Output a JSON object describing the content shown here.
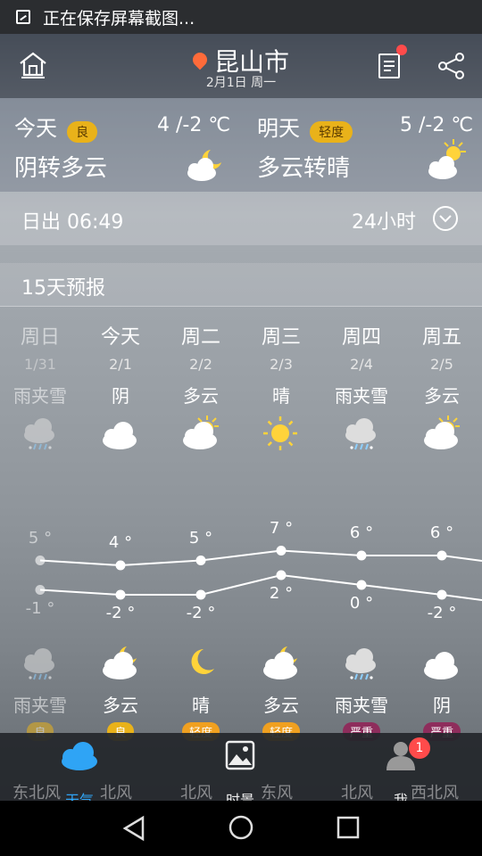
{
  "status_bar": {
    "text": "正在保存屏幕截图..."
  },
  "header": {
    "city": "昆山市",
    "date": "2月1日 周一"
  },
  "today": {
    "label": "今天",
    "aqi": "良",
    "temp": "4 /-2 ℃",
    "condition": "阴转多云",
    "icon": "partly-cloudy-night-icon"
  },
  "tomorrow": {
    "label": "明天",
    "aqi": "轻度",
    "temp": "5 /-2 ℃",
    "condition": "多云转晴",
    "icon": "partly-cloudy-day-icon"
  },
  "sun": {
    "sunrise": "日出 06:49",
    "hours_label": "24小时"
  },
  "forecast": {
    "title": "15天预报",
    "days": [
      {
        "weekday": "周日",
        "date": "1/31",
        "day_cond": "雨夹雪",
        "day_icon": "sleet-icon",
        "high": "5 °",
        "low": "-1 °",
        "night_icon": "sleet-icon",
        "night_cond": "雨夹雪",
        "aqi": "良",
        "aqi_color": "#e9b21a",
        "wind": "东北风"
      },
      {
        "weekday": "今天",
        "date": "2/1",
        "day_cond": "阴",
        "day_icon": "cloud-icon",
        "high": "4 °",
        "low": "-2 °",
        "night_icon": "partly-cloudy-night-icon",
        "night_cond": "多云",
        "aqi": "良",
        "aqi_color": "#e9b21a",
        "wind": "北风"
      },
      {
        "weekday": "周二",
        "date": "2/2",
        "day_cond": "多云",
        "day_icon": "partly-cloudy-day-icon",
        "high": "5 °",
        "low": "-2 °",
        "night_icon": "moon-icon",
        "night_cond": "晴",
        "aqi": "轻度",
        "aqi_color": "#f0a020",
        "wind": "北风"
      },
      {
        "weekday": "周三",
        "date": "2/3",
        "day_cond": "晴",
        "day_icon": "sun-icon",
        "high": "7 °",
        "low": "2 °",
        "night_icon": "partly-cloudy-night-icon",
        "night_cond": "多云",
        "aqi": "轻度",
        "aqi_color": "#f0a020",
        "wind": "东风"
      },
      {
        "weekday": "周四",
        "date": "2/4",
        "day_cond": "雨夹雪",
        "day_icon": "sleet-icon",
        "high": "6 °",
        "low": "0 °",
        "night_icon": "sleet-icon",
        "night_cond": "雨夹雪",
        "aqi": "严重",
        "aqi_color": "#8e2d5c",
        "wind": "北风"
      },
      {
        "weekday": "周五",
        "date": "2/5",
        "day_cond": "多云",
        "day_icon": "partly-cloudy-day-icon",
        "high": "6 °",
        "low": "-2 °",
        "night_icon": "cloud-icon",
        "night_cond": "阴",
        "aqi": "严重",
        "aqi_color": "#8e2d5c",
        "wind": "西北风"
      }
    ],
    "highs": [
      5,
      4,
      5,
      7,
      6,
      6
    ],
    "lows": [
      -1,
      -2,
      -2,
      2,
      0,
      -2
    ]
  },
  "tabs": [
    {
      "label": "天气",
      "icon": "cloud-icon",
      "active": true
    },
    {
      "label": "时景",
      "icon": "picture-icon",
      "active": false
    },
    {
      "label": "我",
      "icon": "user-icon",
      "active": false,
      "badge": "1"
    }
  ]
}
